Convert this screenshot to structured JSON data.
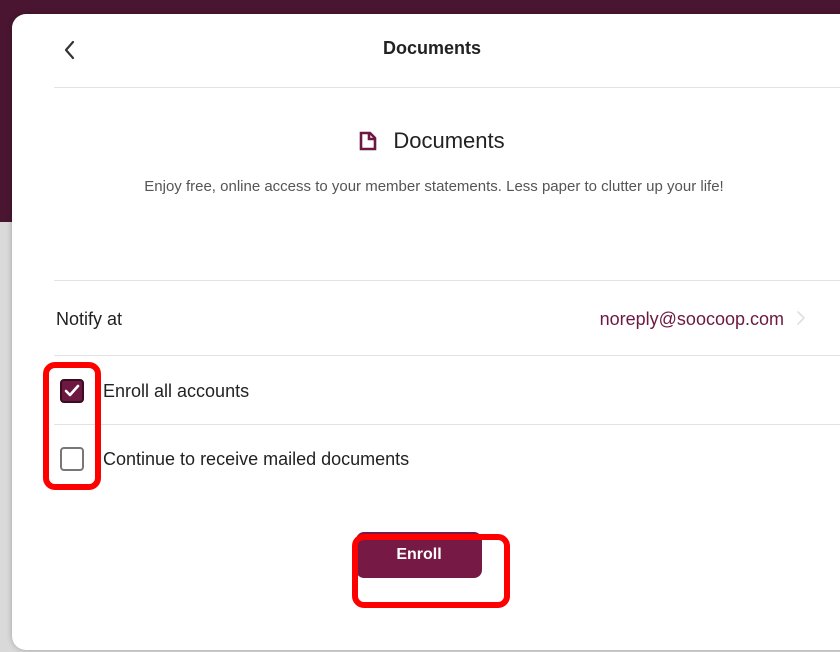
{
  "header": {
    "title": "Documents"
  },
  "section": {
    "title": "Documents",
    "icon": "document-icon",
    "description": "Enjoy free, online access to your member statements. Less paper to clutter up your life!"
  },
  "notify": {
    "label": "Notify at",
    "email": "noreply@soocoop.com"
  },
  "options": [
    {
      "label": "Enroll all accounts",
      "checked": true
    },
    {
      "label": "Continue to receive mailed documents",
      "checked": false
    }
  ],
  "actions": {
    "enroll_label": "Enroll"
  },
  "colors": {
    "brand": "#6d1840",
    "button": "#761a45",
    "highlight": "#ff0000"
  }
}
